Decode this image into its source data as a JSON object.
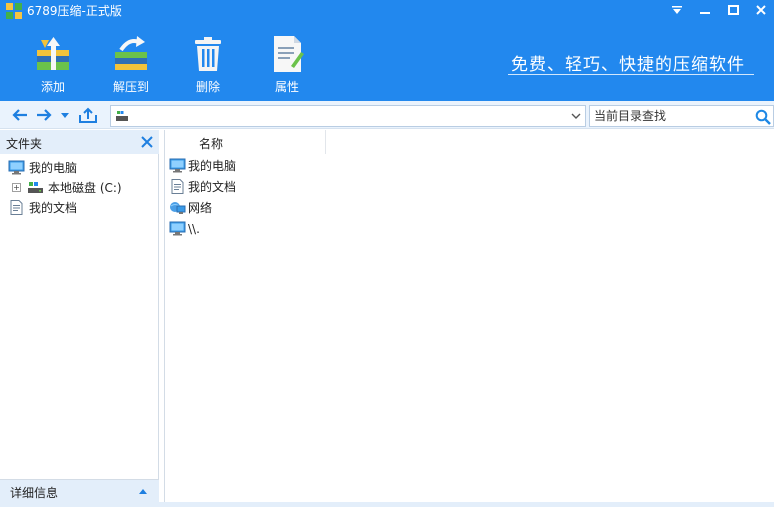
{
  "window": {
    "title": "6789压缩-正式版"
  },
  "toolbar": {
    "add_label": "添加",
    "extract_label": "解压到",
    "delete_label": "删除",
    "properties_label": "属性"
  },
  "slogan": "免费、轻巧、快捷的压缩软件",
  "address": {
    "value": "",
    "search_placeholder": "当前目录查找"
  },
  "folder_panel": {
    "title": "文件夹",
    "tree": [
      {
        "label": "我的电脑",
        "icon": "computer-icon"
      },
      {
        "label": "本地磁盘 (C:)",
        "icon": "drive-icon",
        "expander": "+"
      },
      {
        "label": "我的文档",
        "icon": "document-icon"
      }
    ],
    "detail_label": "详细信息"
  },
  "file_list": {
    "column_name": "名称",
    "rows": [
      {
        "label": "我的电脑",
        "icon": "computer-icon"
      },
      {
        "label": "我的文档",
        "icon": "document-icon"
      },
      {
        "label": "网络",
        "icon": "network-icon"
      },
      {
        "label": "\\\\.",
        "icon": "computer-icon"
      }
    ]
  },
  "colors": {
    "header_blue": "#2288ee",
    "panel_light": "#e3eefa",
    "accent": "#1e88e5"
  }
}
